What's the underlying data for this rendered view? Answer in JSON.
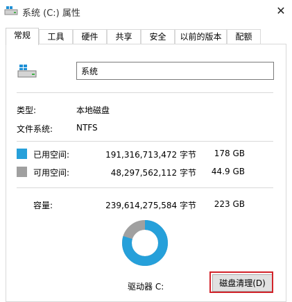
{
  "window": {
    "title": "系统 (C:) 属性",
    "close_glyph": "✕"
  },
  "tabs": [
    {
      "label": "常规",
      "active": true
    },
    {
      "label": "工具"
    },
    {
      "label": "硬件"
    },
    {
      "label": "共享"
    },
    {
      "label": "安全"
    },
    {
      "label": "以前的版本"
    },
    {
      "label": "配额"
    }
  ],
  "general": {
    "volume_name": "系统",
    "type_label": "类型:",
    "type_value": "本地磁盘",
    "fs_label": "文件系统:",
    "fs_value": "NTFS",
    "used": {
      "label": "已用空间:",
      "bytes": "191,316,713,472 字节",
      "size": "178 GB",
      "color": "#26a0da"
    },
    "free": {
      "label": "可用空间:",
      "bytes": "48,297,562,112 字节",
      "size": "44.9 GB",
      "color": "#a0a0a0"
    },
    "capacity": {
      "label": "容量:",
      "bytes": "239,614,275,584 字节",
      "size": "223 GB"
    },
    "drive_label": "驱动器 C:",
    "used_fraction": 0.798,
    "cleanup_button": "磁盘清理(D)"
  },
  "icons": {
    "title": "drive-icon",
    "close": "close-icon",
    "drive": "drive-icon"
  }
}
